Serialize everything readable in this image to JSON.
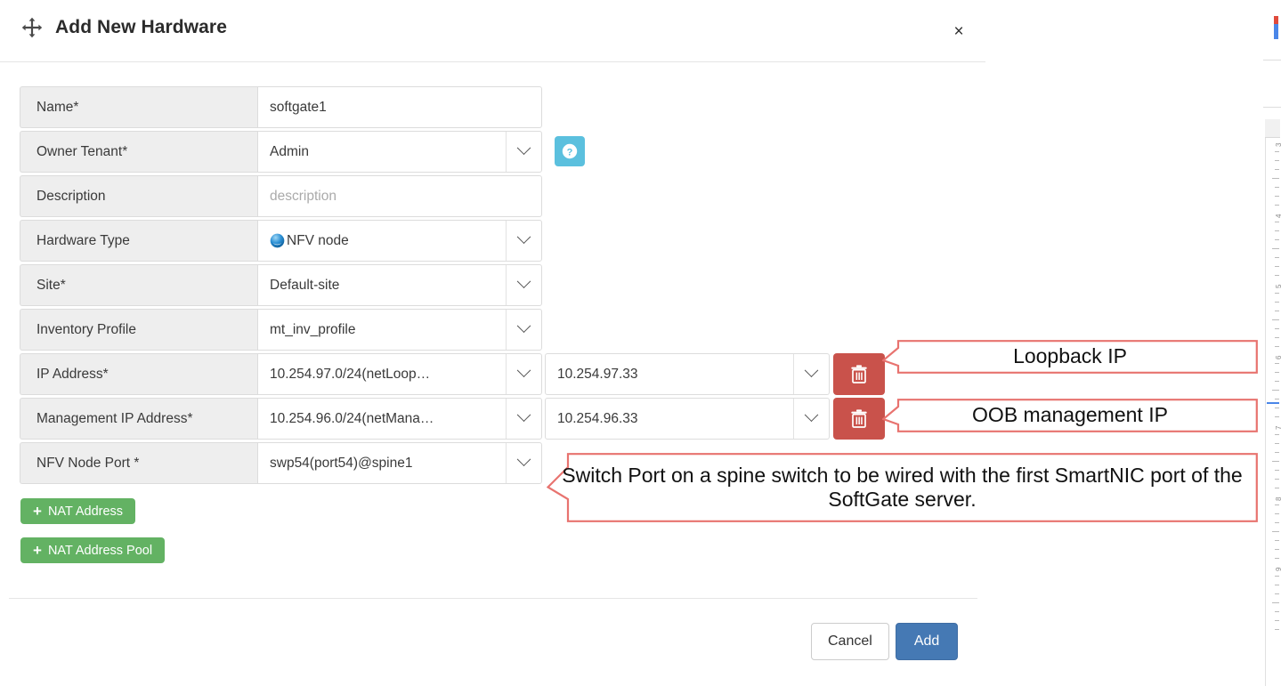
{
  "modal": {
    "title": "Add New Hardware",
    "move_icon": "move-arrows-icon",
    "close_label": "×",
    "help_icon_label": "?"
  },
  "form": {
    "rows": [
      {
        "label": "Name*",
        "type": "text",
        "value": "softgate1",
        "placeholder": "",
        "has_caret": false
      },
      {
        "label": "Owner Tenant*",
        "type": "select",
        "value": "Admin",
        "has_caret": true,
        "has_help": true
      },
      {
        "label": "Description",
        "type": "text",
        "value": "",
        "placeholder": "description",
        "has_caret": false
      },
      {
        "label": "Hardware Type",
        "type": "select",
        "value": "NFV node",
        "icon": "nfv-node-icon",
        "has_caret": true
      },
      {
        "label": "Site*",
        "type": "select",
        "value": "Default-site",
        "has_caret": true
      },
      {
        "label": "Inventory Profile",
        "type": "select",
        "value": "mt_inv_profile",
        "has_caret": true
      },
      {
        "label": "IP Address*",
        "type": "select-pair",
        "value": "10.254.97.0/24(netLoop…",
        "value2": "10.254.97.33",
        "has_caret": true,
        "has_delete": true,
        "delete_icon": "trash-icon"
      },
      {
        "label": "Management IP Address*",
        "type": "select-pair",
        "value": "10.254.96.0/24(netMana…",
        "value2": "10.254.96.33",
        "has_caret": true,
        "has_delete": true,
        "delete_icon": "trash-icon"
      },
      {
        "label": "NFV Node Port *",
        "type": "select",
        "value": "swp54(port54)@spine1",
        "has_caret": true
      }
    ]
  },
  "nat_buttons": [
    {
      "label": "NAT Address",
      "plus": "+"
    },
    {
      "label": "NAT Address Pool",
      "plus": "+"
    }
  ],
  "footer": {
    "cancel_label": "Cancel",
    "add_label": "Add"
  },
  "annotations": [
    {
      "id": "loopback",
      "text": "Loopback IP"
    },
    {
      "id": "oob",
      "text": "OOB management IP"
    },
    {
      "id": "switchport",
      "text": "Switch Port on a spine switch to be wired with the first SmartNIC port of the SoftGate server."
    }
  ],
  "ruler": {
    "numbers": [
      "3",
      "4",
      "5",
      "6",
      "7",
      "8",
      "9"
    ]
  },
  "colors": {
    "accent_primary": "#4579b4",
    "delete_red": "#c9524b",
    "success_green": "#63b263",
    "help_blue": "#5bc0de",
    "annotation_red": "#e8736f",
    "label_bg": "#eeeeee",
    "border": "#dcdcdc"
  }
}
